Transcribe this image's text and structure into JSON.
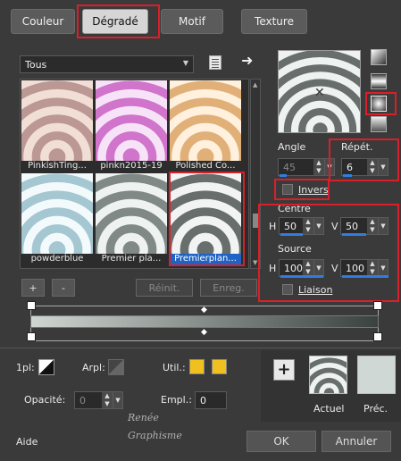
{
  "tabs": [
    "Couleur",
    "Dégradé",
    "Motif",
    "Texture"
  ],
  "filter": {
    "value": "Tous"
  },
  "gradients": [
    {
      "name": "PinkishTing...",
      "colors": [
        "#f1dfd6",
        "#a8807c"
      ]
    },
    {
      "name": "pinkn2015-19",
      "colors": [
        "#f7e3f7",
        "#c34fbd"
      ]
    },
    {
      "name": "Polished Co...",
      "colors": [
        "#fff1dd",
        "#d59a55"
      ]
    },
    {
      "name": "powderblue",
      "colors": [
        "#f3fafc",
        "#8ab5c4"
      ]
    },
    {
      "name": "Premier pla...",
      "colors": [
        "#eef2f0",
        "#5b6662"
      ]
    },
    {
      "name": "Premierplan...",
      "colors": [
        "#f2f4f3",
        "#3a423f"
      ]
    }
  ],
  "buttons": {
    "add": "+",
    "remove": "-",
    "reset": "Réinit.",
    "save": "Enreg.",
    "ok": "OK",
    "cancel": "Annuler",
    "help": "Aide"
  },
  "angle": {
    "label": "Angle",
    "value": "45"
  },
  "repeat": {
    "label": "Répét.",
    "value": "6"
  },
  "invert": {
    "label": "Invers"
  },
  "center": {
    "label": "Centre",
    "h_label": "H",
    "h": "50",
    "v_label": "V",
    "v": "50"
  },
  "source": {
    "label": "Source",
    "h_label": "H",
    "h": "100",
    "v_label": "V",
    "v": "100"
  },
  "link": {
    "label": "Liaison"
  },
  "stops": {
    "first_label": "1pl:",
    "arpl_label": "Arpl:",
    "util_label": "Util.:",
    "opacity_label": "Opacité:",
    "opacity_value": "0",
    "empl_label": "Empl.:",
    "empl_value": "0",
    "util_color": "#f0c020"
  },
  "preview": {
    "current_label": "Actuel",
    "prev_label": "Préc."
  },
  "watermark": [
    "Renée",
    "Graphisme"
  ]
}
